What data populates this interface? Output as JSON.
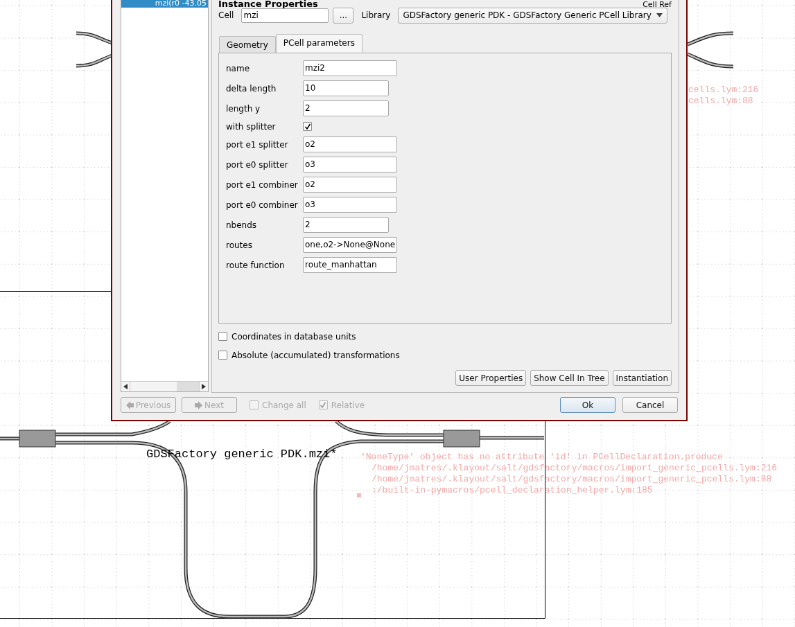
{
  "layout": {
    "cell_label": "GDSFactory generic PDK.mzi*",
    "error_lines": [
      "'NoneType' object has no attribute 'id' in PCellDeclaration.produce",
      "/home/jmatres/.klayout/salt/gdsfactory/macros/import_generic_pcells.lym:216",
      "/home/jmatres/.klayout/salt/gdsfactory/macros/import_generic_pcells.lym:88",
      ":/built-in-pymacros/pcell_declaration_helper.lym:185"
    ],
    "side_error_lines": [
      "cells.lym:216",
      "cells.lym:88"
    ]
  },
  "dialog": {
    "title": "Instance Properties",
    "title_right": "Cell Ref",
    "instance_list": [
      {
        "label": "mzi(r0 -43.05",
        "selected": true
      }
    ],
    "cell": {
      "label": "Cell",
      "value": "mzi",
      "browse_button": "..."
    },
    "library": {
      "label": "Library",
      "value": "GDSFactory generic PDK - GDSFactory Generic PCell Library"
    },
    "tabs": [
      {
        "label": "Geometry",
        "selected": false
      },
      {
        "label": "PCell parameters",
        "selected": true
      }
    ],
    "parameters": [
      {
        "kind": "string",
        "label": "name",
        "value": "mzi2"
      },
      {
        "kind": "number",
        "label": "delta length",
        "value": "10"
      },
      {
        "kind": "number",
        "label": "length y",
        "value": "2"
      },
      {
        "kind": "bool",
        "label": "with splitter",
        "checked": true
      },
      {
        "kind": "string",
        "label": "port e1 splitter",
        "value": "o2"
      },
      {
        "kind": "string",
        "label": "port e0 splitter",
        "value": "o3"
      },
      {
        "kind": "string",
        "label": "port e1 combiner",
        "value": "o2"
      },
      {
        "kind": "string",
        "label": "port e0 combiner",
        "value": "o3"
      },
      {
        "kind": "number",
        "label": "nbends",
        "value": "2"
      },
      {
        "kind": "string",
        "label": "routes",
        "value": "one,o2->None@None"
      },
      {
        "kind": "string",
        "label": "route function",
        "value": "route_manhattan"
      }
    ],
    "options": [
      {
        "label": "Coordinates in database units",
        "checked": false
      },
      {
        "label": "Absolute (accumulated) transformations",
        "checked": false
      }
    ],
    "action_buttons": [
      "User Properties",
      "Show Cell In Tree",
      "Instantiation"
    ],
    "navigation": [
      {
        "kind": "button",
        "label": "Previous",
        "disabled": true
      },
      {
        "kind": "button",
        "label": "Next",
        "disabled": true
      },
      {
        "kind": "checkbox",
        "label": "Change all",
        "checked": false,
        "disabled": true
      },
      {
        "kind": "checkbox",
        "label": "Relative",
        "checked": true,
        "disabled": true
      }
    ],
    "dialog_buttons": [
      {
        "label": "Ok",
        "default": true
      },
      {
        "label": "Cancel",
        "default": false
      }
    ]
  }
}
